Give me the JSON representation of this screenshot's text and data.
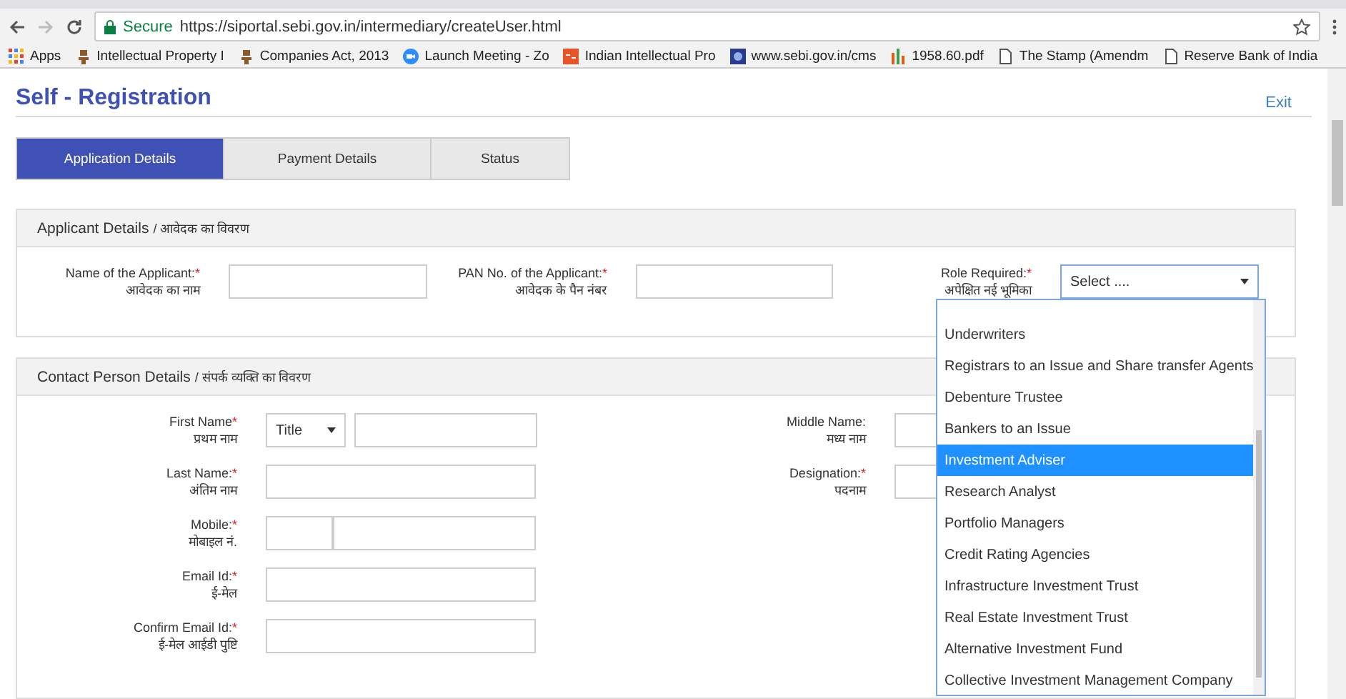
{
  "browser": {
    "secure": "Secure",
    "url": "https://siportal.sebi.gov.in/intermediary/createUser.html",
    "bookmarks": [
      {
        "label": "Apps"
      },
      {
        "label": "Intellectual Property I"
      },
      {
        "label": "Companies Act, 2013"
      },
      {
        "label": "Launch Meeting - Zo"
      },
      {
        "label": "Indian Intellectual Pro"
      },
      {
        "label": "www.sebi.gov.in/cms"
      },
      {
        "label": "1958.60.pdf"
      },
      {
        "label": "The Stamp (Amendm"
      },
      {
        "label": "Reserve Bank of India"
      }
    ]
  },
  "page": {
    "title": "Self - Registration",
    "exit": "Exit"
  },
  "tabs": [
    {
      "label": "Application Details",
      "selected": true
    },
    {
      "label": "Payment Details",
      "selected": false
    },
    {
      "label": "Status",
      "selected": false
    }
  ],
  "applicant_section": {
    "title": "Applicant Details",
    "title_hindi": "/ आवेदक का विवरण",
    "fields": [
      {
        "label": "Name of the Applicant:",
        "mark": "*",
        "hindi": "आवेदक का नाम"
      },
      {
        "label": "PAN No. of the Applicant:",
        "mark": "*",
        "hindi": "आवेदक के पैन नंबर"
      }
    ],
    "role": {
      "label": "Role Required:",
      "mark": "*",
      "hindi": "अपेक्षित नई भूमिका",
      "value": "Select ....",
      "options": [
        {
          "label": "Underwriters",
          "selected": false
        },
        {
          "label": "Registrars to an Issue and Share transfer Agents",
          "selected": false
        },
        {
          "label": "Debenture Trustee",
          "selected": false
        },
        {
          "label": "Bankers to an Issue",
          "selected": false
        },
        {
          "label": "Investment Adviser",
          "selected": true
        },
        {
          "label": "Research Analyst",
          "selected": false
        },
        {
          "label": "Portfolio Managers",
          "selected": false
        },
        {
          "label": "Credit Rating Agencies",
          "selected": false
        },
        {
          "label": "Infrastructure Investment Trust",
          "selected": false
        },
        {
          "label": "Real Estate Investment Trust",
          "selected": false
        },
        {
          "label": "Alternative Investment Fund",
          "selected": false
        },
        {
          "label": "Collective Investment Management Company",
          "selected": false
        }
      ]
    }
  },
  "contact_section": {
    "title": "Contact Person Details",
    "title_hindi": "/ संपर्क व्यक्ति का विवरण",
    "left_fields": [
      {
        "label": "First Name",
        "mark": "*",
        "hindi": "प्रथम नाम",
        "kind": "title_name",
        "select": "Title"
      },
      {
        "label": "Last Name:",
        "mark": "*",
        "hindi": "अंतिम नाम",
        "kind": "input"
      },
      {
        "label": "Mobile:",
        "mark": "*",
        "hindi": "मोबाइल नं.",
        "kind": "mobile"
      },
      {
        "label": "Email Id:",
        "mark": "*",
        "hindi": "ई-मेल",
        "kind": "input"
      },
      {
        "label": "Confirm Email Id:",
        "mark": "*",
        "hindi": "ई-मेल आईडी पुष्टि",
        "kind": "input"
      }
    ],
    "right_fields": [
      {
        "label": "Middle Name:",
        "hindi": "मध्य नाम",
        "kind": "input"
      },
      {
        "label": "Designation:",
        "mark": "*",
        "hindi": "पदनाम",
        "kind": "input"
      }
    ]
  }
}
